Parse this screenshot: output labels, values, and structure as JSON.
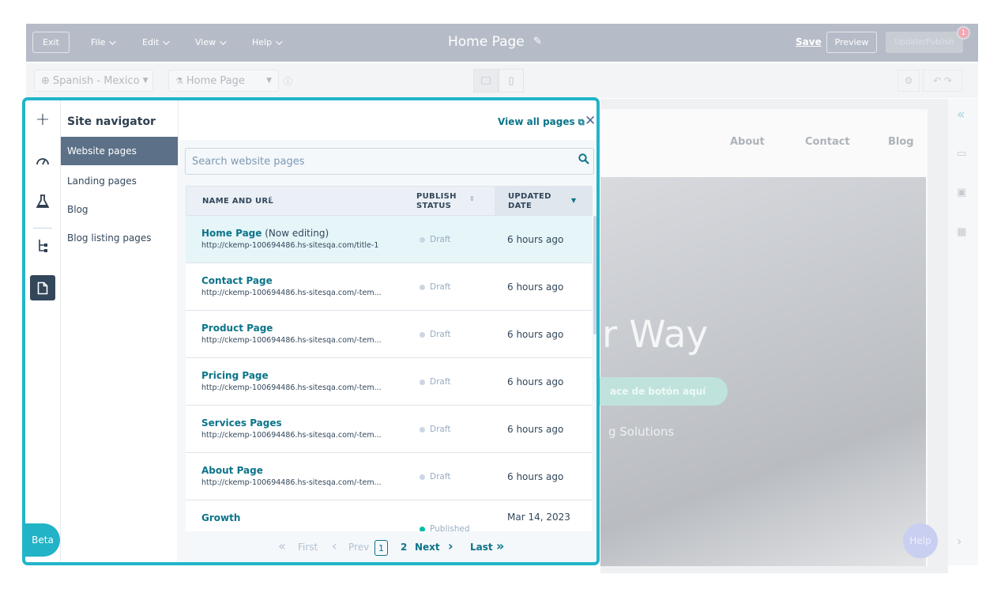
{
  "topbar": {
    "exit_label": "Exit",
    "menus": [
      "File",
      "Edit",
      "View",
      "Help"
    ],
    "page_title": "Home Page",
    "save_label": "Save",
    "preview_label": "Preview",
    "update_label": "Update/Publish",
    "notification_count": "1"
  },
  "toolbar": {
    "language": "Spanish - Mexico",
    "page_select": "Home Page"
  },
  "preview": {
    "nav_items": [
      "About",
      "Contact",
      "Blog"
    ],
    "hero_text": "r Way",
    "button_text": "ace de botón aquí",
    "subtitle": "g Solutions",
    "help_label": "Help"
  },
  "navigator": {
    "title": "Site navigator",
    "view_all": "View all pages",
    "beta_label": "Beta",
    "categories": [
      {
        "label": "Website pages",
        "active": true
      },
      {
        "label": "Landing pages",
        "active": false
      },
      {
        "label": "Blog",
        "active": false
      },
      {
        "label": "Blog listing pages",
        "active": false
      }
    ],
    "search_placeholder": "Search website pages",
    "columns": {
      "name": "NAME AND URL",
      "status_1": "PUBLISH",
      "status_2": "STATUS",
      "updated_1": "UPDATED",
      "updated_2": "DATE"
    },
    "rows": [
      {
        "name": "Home Page",
        "suffix": " (Now editing)",
        "url": "http://ckemp-100694486.hs-sitesqa.com/title-1",
        "status": "Draft",
        "updated": "6 hours ago"
      },
      {
        "name": "Contact Page",
        "suffix": "",
        "url": "http://ckemp-100694486.hs-sitesqa.com/-tem...",
        "status": "Draft",
        "updated": "6 hours ago"
      },
      {
        "name": "Product Page",
        "suffix": "",
        "url": "http://ckemp-100694486.hs-sitesqa.com/-tem...",
        "status": "Draft",
        "updated": "6 hours ago"
      },
      {
        "name": "Pricing Page",
        "suffix": "",
        "url": "http://ckemp-100694486.hs-sitesqa.com/-tem...",
        "status": "Draft",
        "updated": "6 hours ago"
      },
      {
        "name": "Services Pages",
        "suffix": "",
        "url": "http://ckemp-100694486.hs-sitesqa.com/-tem...",
        "status": "Draft",
        "updated": "6 hours ago"
      },
      {
        "name": "About Page",
        "suffix": "",
        "url": "http://ckemp-100694486.hs-sitesqa.com/-tem...",
        "status": "Draft",
        "updated": "6 hours ago"
      },
      {
        "name": "Growth",
        "suffix": "",
        "url": "",
        "status": "Published",
        "updated": "Mar 14, 2023"
      }
    ],
    "pagination": {
      "first": "First",
      "prev": "Prev",
      "current": "1",
      "page2": "2",
      "next": "Next",
      "last": "Last"
    }
  },
  "colors": {
    "accent": "#21b5c9",
    "link": "#0b7489",
    "active_nav": "#5c7088",
    "topbar": "#b6bcc7"
  }
}
